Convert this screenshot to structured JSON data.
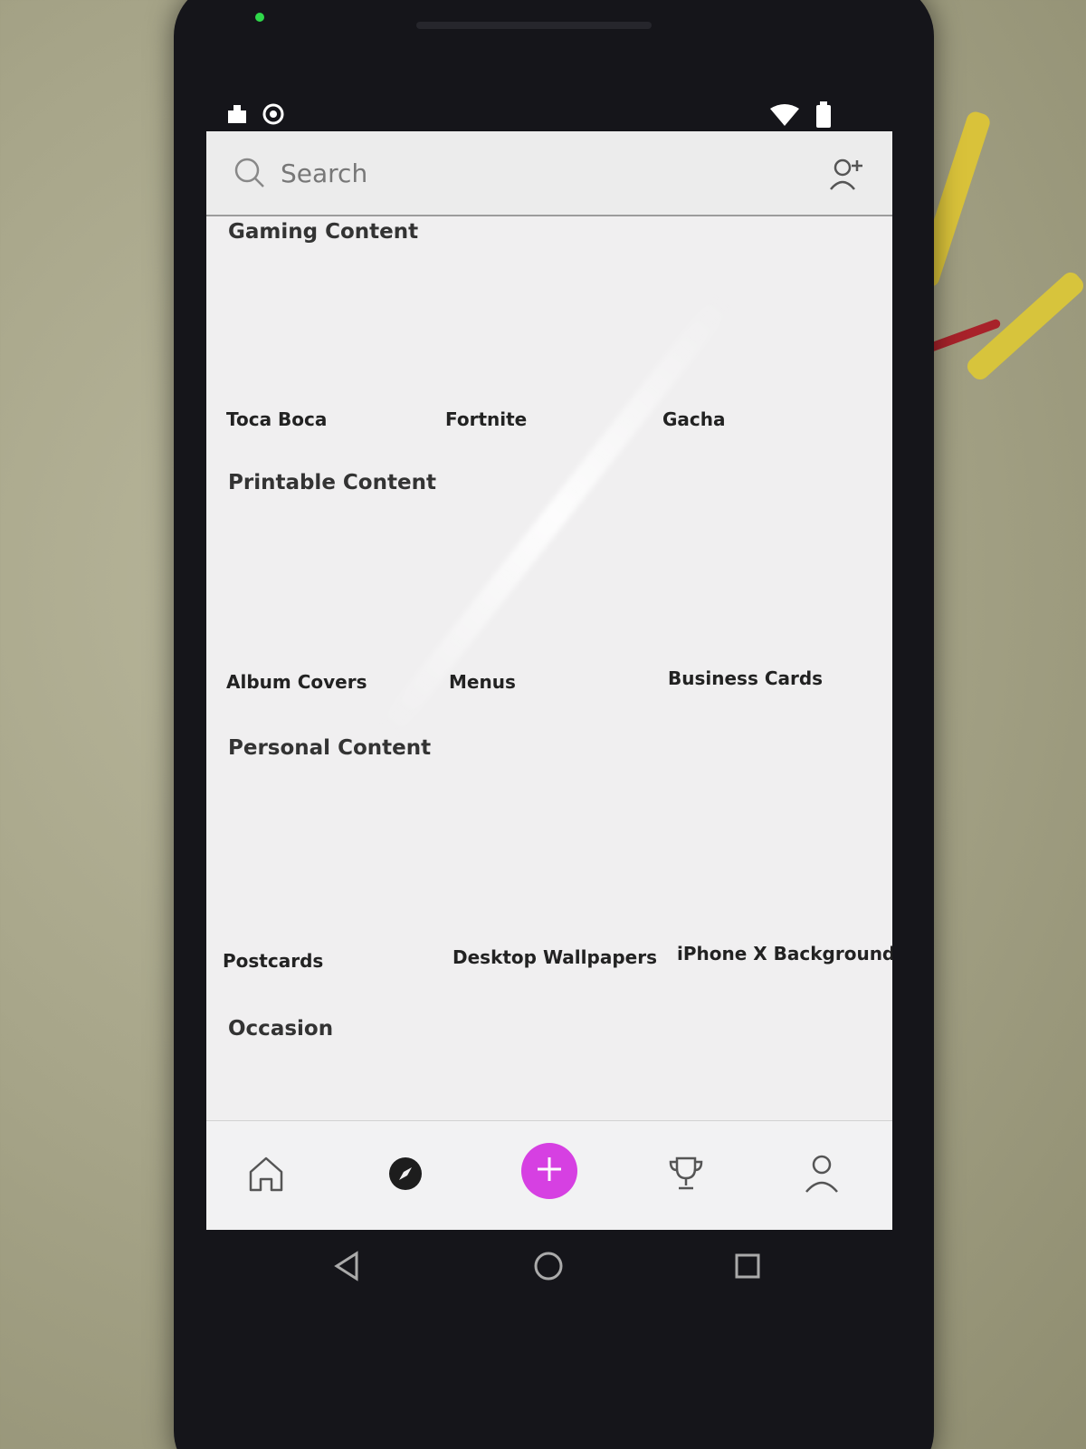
{
  "search": {
    "placeholder": "Search"
  },
  "sections": [
    {
      "title": "Gaming Content",
      "items": [
        "Toca Boca",
        "Fortnite",
        "Gacha"
      ]
    },
    {
      "title": "Printable Content",
      "items": [
        "Album Covers",
        "Menus",
        "Business Cards"
      ]
    },
    {
      "title": "Personal Content",
      "items": [
        "Postcards",
        "Desktop Wallpapers",
        "iPhone X Backgrounds"
      ]
    },
    {
      "title": "Occasion",
      "items": []
    }
  ],
  "bottom_nav": [
    {
      "name": "home",
      "icon": "home-icon"
    },
    {
      "name": "explore",
      "icon": "compass-icon"
    },
    {
      "name": "create",
      "icon": "plus-icon"
    },
    {
      "name": "challenges",
      "icon": "trophy-icon"
    },
    {
      "name": "profile",
      "icon": "user-icon"
    }
  ],
  "colors": {
    "accent": "#d640e2",
    "screen_bg": "#f0eff0",
    "phone_body": "#15151a"
  }
}
